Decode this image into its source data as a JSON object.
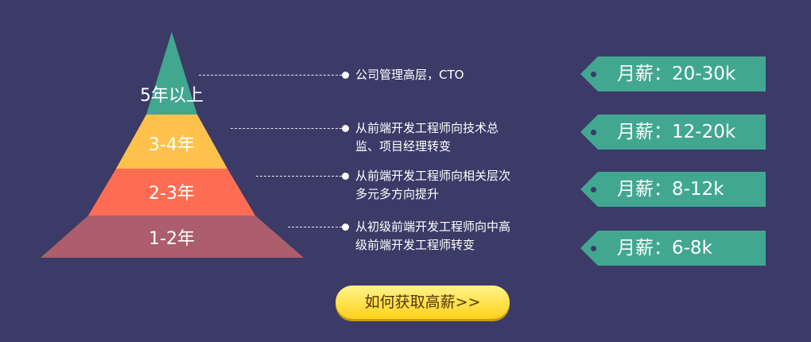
{
  "colors": {
    "background": "#3c3a67",
    "tier_1": "#42a790",
    "tier_2": "#fec24c",
    "tier_3": "#fe6d53",
    "tier_4": "#ad5e6c",
    "tag": "#42a790",
    "button": "#ffd21a"
  },
  "tiers": [
    {
      "label": "5年以上",
      "desc_line1": "公司管理高层，CTO",
      "desc_line2": "",
      "salary": "月薪：20-30k"
    },
    {
      "label": "3-4年",
      "desc_line1": "从前端开发工程师向技术总",
      "desc_line2": "监、项目经理转变",
      "salary": "月薪：12-20k"
    },
    {
      "label": "2-3年",
      "desc_line1": "从前端开发工程师向相关层次",
      "desc_line2": "多元多方向提升",
      "salary": "月薪：8-12k"
    },
    {
      "label": "1-2年",
      "desc_line1": "从初级前端开发工程师向中高",
      "desc_line2": "级前端开发工程师转变",
      "salary": "月薪：6-8k"
    }
  ],
  "cta": {
    "label": "如何获取高薪>>"
  }
}
